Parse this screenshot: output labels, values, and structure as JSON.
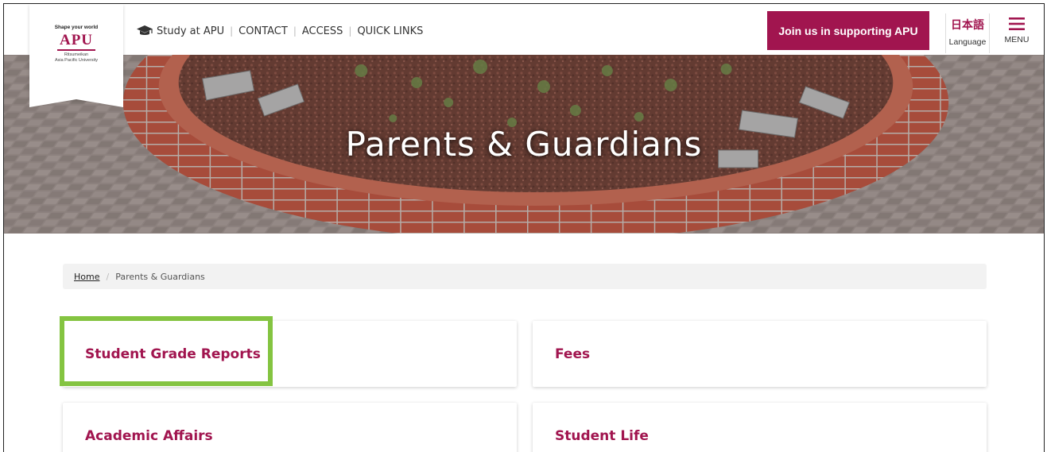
{
  "logo": {
    "tagline": "Shape your world",
    "mark": "APU",
    "sub_line1": "Ritsumeikan",
    "sub_line2": "Asia Pacific University"
  },
  "topnav": {
    "items": [
      {
        "label": "Study at APU",
        "icon": "graduation-cap-icon"
      },
      {
        "label": "CONTACT"
      },
      {
        "label": "ACCESS"
      },
      {
        "label": "QUICK LINKS"
      }
    ],
    "separator": "|"
  },
  "header": {
    "support_button": "Join us in supporting APU",
    "language_jp": "日本語",
    "language_label": "Language",
    "menu_icon": "hamburger-icon",
    "menu_label": "MENU"
  },
  "hero": {
    "title": "Parents & Guardians"
  },
  "breadcrumb": {
    "home": "Home",
    "separator": "/",
    "current": "Parents & Guardians"
  },
  "cards": [
    {
      "label": "Student Grade Reports",
      "highlighted": true
    },
    {
      "label": "Fees"
    },
    {
      "label": "Academic Affairs"
    },
    {
      "label": "Student Life"
    }
  ],
  "colors": {
    "brand": "#a1154f",
    "highlight": "#84c441",
    "breadcrumb_bg": "#f2f2f2"
  }
}
